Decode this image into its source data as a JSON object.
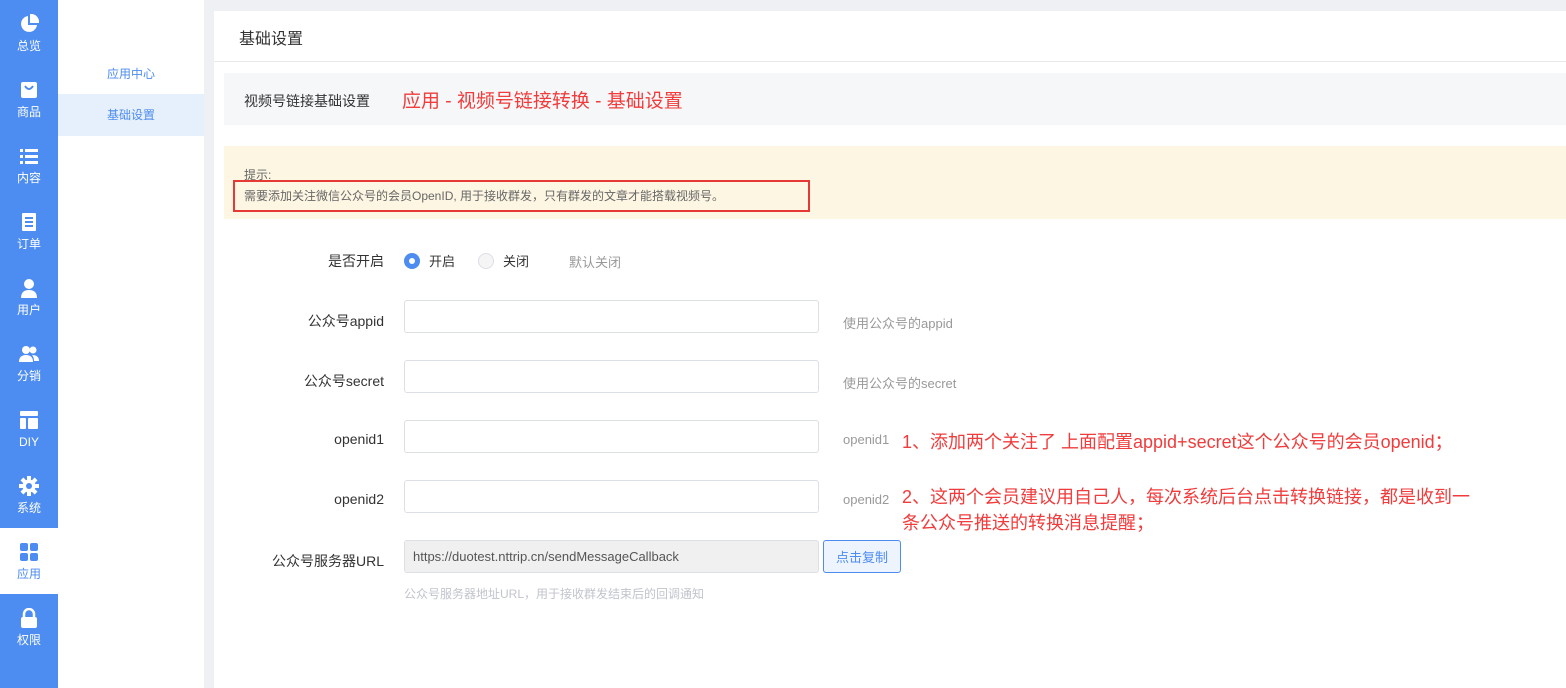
{
  "nav": {
    "items": [
      {
        "label": "总览",
        "icon": "pie-chart-icon"
      },
      {
        "label": "商品",
        "icon": "shopping-bag-icon"
      },
      {
        "label": "内容",
        "icon": "list-icon"
      },
      {
        "label": "订单",
        "icon": "document-icon"
      },
      {
        "label": "用户",
        "icon": "user-icon"
      },
      {
        "label": "分销",
        "icon": "users-icon"
      },
      {
        "label": "DIY",
        "icon": "layout-icon"
      },
      {
        "label": "系统",
        "icon": "gear-icon"
      },
      {
        "label": "应用",
        "icon": "apps-grid-icon",
        "active": true
      },
      {
        "label": "权限",
        "icon": "lock-icon"
      }
    ]
  },
  "submenu": {
    "items": [
      {
        "label": "应用中心"
      },
      {
        "label": "基础设置",
        "active": true
      }
    ]
  },
  "page": {
    "title": "基础设置",
    "section_title": "视频号链接基础设置",
    "section_annotation": "应用 - 视频号链接转换 - 基础设置"
  },
  "tip": {
    "heading": "提示:",
    "text": "需要添加关注微信公众号的会员OpenID, 用于接收群发，只有群发的文章才能搭载视频号。"
  },
  "form": {
    "enable": {
      "label": "是否开启",
      "options": [
        "开启",
        "关闭"
      ],
      "selected": "开启",
      "hint": "默认关闭"
    },
    "appid": {
      "label": "公众号appid",
      "value": "",
      "hint": "使用公众号的appid"
    },
    "secret": {
      "label": "公众号secret",
      "value": "",
      "hint": "使用公众号的secret"
    },
    "openid1": {
      "label": "openid1",
      "value": "",
      "hint": "openid1"
    },
    "openid2": {
      "label": "openid2",
      "value": "",
      "hint": "openid2"
    },
    "server_url": {
      "label": "公众号服务器URL",
      "value": "https://duotest.nttrip.cn/sendMessageCallback",
      "copy_button": "点击复制",
      "description": "公众号服务器地址URL，用于接收群发结束后的回调通知"
    }
  },
  "annotations": {
    "note1": "1、添加两个关注了 上面配置appid+secret这个公众号的会员openid；",
    "note2_line1": "2、这两个会员建议用自己人，每次系统后台点击转换链接，都是收到一",
    "note2_line2": "条公众号推送的转换消息提醒；"
  },
  "colors": {
    "nav_bg": "#4d8cf0",
    "accent": "#4d8cf0",
    "annotation_red": "#f03c3c",
    "tip_bg": "#fdf6e3"
  }
}
